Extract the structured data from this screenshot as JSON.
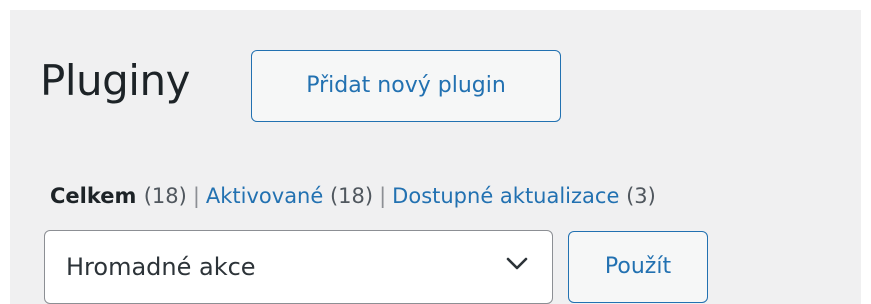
{
  "header": {
    "title": "Pluginy",
    "add_new_label": "Přidat nový plugin"
  },
  "filters": [
    {
      "label": "Celkem",
      "count": "(18)",
      "current": true
    },
    {
      "label": "Aktivované",
      "count": "(18)",
      "current": false
    },
    {
      "label": "Dostupné aktualizace",
      "count": "(3)",
      "current": false
    }
  ],
  "filter_separator": "|",
  "bulk_actions": {
    "selected": "Hromadné akce",
    "apply_label": "Použít"
  },
  "colors": {
    "background": "#f0f0f1",
    "accent": "#2271b1",
    "text": "#1d2327"
  }
}
